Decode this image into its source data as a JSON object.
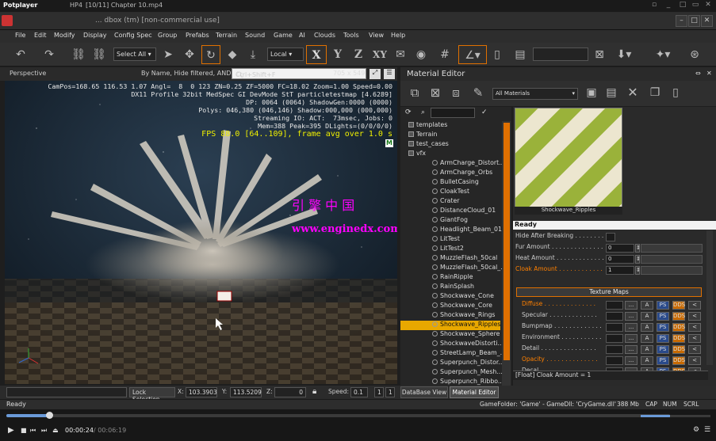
{
  "potplayer": {
    "app_name": "Potplayer",
    "tab1": "HP4",
    "file_title": "[10/11] Chapter 10.mp4",
    "elapsed": "00:00:24",
    "total": "/ 00:06:19"
  },
  "sandbox": {
    "title": "... dbox (tm) [non-commercial use]"
  },
  "menu": [
    "File",
    "Edit",
    "Modify",
    "Display",
    "Config Spec",
    "Group",
    "Prefabs",
    "Terrain",
    "Sound",
    "Game",
    "AI",
    "Clouds",
    "Tools",
    "View",
    "Help"
  ],
  "toolbar": {
    "select_all": "Select All",
    "coord_system": "Local",
    "axis_x": "X",
    "axis_y": "Y",
    "axis_z": "Z",
    "axis_xy": "XY"
  },
  "viewport": {
    "title": "Perspective",
    "filter_text": "By Name, Hide filtered, AND",
    "search_shortcut": "Ctrl+Shift+F",
    "resolution": "705 x 549",
    "stats": [
      "CamPos=168.65 116.53 1.07 Angl=  8  0 123 ZN=0.25 ZF=5000 FC=18.02 Zoom=1.00 Speed=0.00",
      "DX11 Profile 32bit MedSpec GI DevMode StT particletestmap [4.6289]",
      "DP: 0064 (0064) ShadowGen:0000 (0000)",
      "Polys: 046,380 (046,146) Shadow:000,000 (000,000)",
      "Streaming IO: ACT:  73msec, Jobs: 0",
      "Mem=388 Peak=395 DLights=(0/0/0/0)"
    ],
    "fps": "FPS 88.0 [64..109], frame avg over 1.0 s",
    "mode_badge": "M",
    "watermark_cn": "引 擎 中 国",
    "watermark_url": "www.enginedx.com"
  },
  "material_editor": {
    "title": "Material Editor",
    "filter_select": "All Materials",
    "tree": [
      {
        "label": "templates",
        "kind": "folder",
        "level": 0
      },
      {
        "label": "Terrain",
        "kind": "folder",
        "level": 0
      },
      {
        "label": "test_cases",
        "kind": "folder",
        "level": 0
      },
      {
        "label": "vfx",
        "kind": "folder",
        "level": 0
      },
      {
        "label": "ArmCharge_Distort...",
        "kind": "item",
        "level": 1
      },
      {
        "label": "ArmCharge_Orbs",
        "kind": "item",
        "level": 1
      },
      {
        "label": "BulletCasing",
        "kind": "item",
        "level": 1
      },
      {
        "label": "CloakTest",
        "kind": "item",
        "level": 1
      },
      {
        "label": "Crater",
        "kind": "item",
        "level": 1
      },
      {
        "label": "DistanceCloud_01",
        "kind": "item",
        "level": 1
      },
      {
        "label": "GiantFog",
        "kind": "item",
        "level": 1
      },
      {
        "label": "Headlight_Beam_01",
        "kind": "item",
        "level": 1
      },
      {
        "label": "LitTest",
        "kind": "item",
        "level": 1
      },
      {
        "label": "LitTest2",
        "kind": "item",
        "level": 1
      },
      {
        "label": "MuzzleFlash_50cal",
        "kind": "item",
        "level": 1
      },
      {
        "label": "MuzzleFlash_50cal_...",
        "kind": "item",
        "level": 1
      },
      {
        "label": "RainRipple",
        "kind": "item",
        "level": 1
      },
      {
        "label": "RainSplash",
        "kind": "item",
        "level": 1
      },
      {
        "label": "Shockwave_Cone",
        "kind": "item",
        "level": 1
      },
      {
        "label": "Shockwave_Core",
        "kind": "item",
        "level": 1
      },
      {
        "label": "Shockwave_Rings",
        "kind": "item",
        "level": 1
      },
      {
        "label": "Shockwave_Ripples",
        "kind": "item",
        "level": 1,
        "selected": true
      },
      {
        "label": "Shockwave_Sphere",
        "kind": "item",
        "level": 1
      },
      {
        "label": "ShockwaveDistorti...",
        "kind": "item",
        "level": 1
      },
      {
        "label": "StreetLamp_Beam_...",
        "kind": "item",
        "level": 1
      },
      {
        "label": "Superpunch_Distor...",
        "kind": "item",
        "level": 1
      },
      {
        "label": "Superpunch_Mesh...",
        "kind": "item",
        "level": 1
      },
      {
        "label": "Superpunch_Ribbo...",
        "kind": "item",
        "level": 1
      }
    ],
    "preview_label": "Shockwave_Ripples",
    "status": "Ready",
    "props": [
      {
        "label": "Hide After Breaking . . . . . . . . . .",
        "value": "",
        "highlight": false
      },
      {
        "label": "Fur Amount . . . . . . . . . . . . . .",
        "value": "0",
        "highlight": false
      },
      {
        "label": "Heat Amount . . . . . . . . . . . . .",
        "value": "0",
        "highlight": false
      },
      {
        "label": "Cloak Amount . . . . . . . . . . . .",
        "value": "1",
        "highlight": true
      }
    ],
    "texture_maps_header": "Texture Maps",
    "texture_maps": [
      {
        "label": "Diffuse . . . . . . . . . . . . . .",
        "highlight": true
      },
      {
        "label": "Specular . . . . . . . . . . . . .",
        "highlight": false
      },
      {
        "label": "Bumpmap . . . . . . . . . . . . .",
        "highlight": false
      },
      {
        "label": "Environment . . . . . . . . . . .",
        "highlight": false
      },
      {
        "label": "Detail . . . . . . . . . . . . . . .",
        "highlight": false
      },
      {
        "label": "Opacity . . . . . . . . . . . . . .",
        "highlight": true
      },
      {
        "label": "Decal . . . . . . . . . . . . . . .",
        "highlight": false
      }
    ],
    "tex_buttons": [
      "...",
      "A",
      "PS",
      "DDS",
      "<"
    ],
    "footer_info": "[Float] Cloak Amount = 1",
    "tabs": [
      "DataBase View",
      "Material Editor"
    ]
  },
  "statusbar": {
    "lock_selection": "Lock Selection",
    "x_label": "X:",
    "x_value": "103.3903",
    "y_label": "Y:",
    "y_value": "113.5209",
    "z_label": "Z:",
    "z_value": "0",
    "speed_label": "Speed:",
    "speed_value": "0.1",
    "speed_opt1": "1",
    "speed_opt2": "1",
    "ready": "Ready",
    "game_folder": "GameFolder: 'Game' - GameDll: 'CryGame.dll'",
    "memory": "388 Mb",
    "cap": "CAP",
    "num": "NUM",
    "scrl": "SCRL"
  },
  "colors": {
    "accent_orange": "#e8a800",
    "selection_orange": "#ff8000",
    "panel_bg": "#2a2a2a",
    "watermark_magenta": "#ff00ff"
  },
  "playback": {
    "progress": 0.065,
    "volume": 0.42
  }
}
